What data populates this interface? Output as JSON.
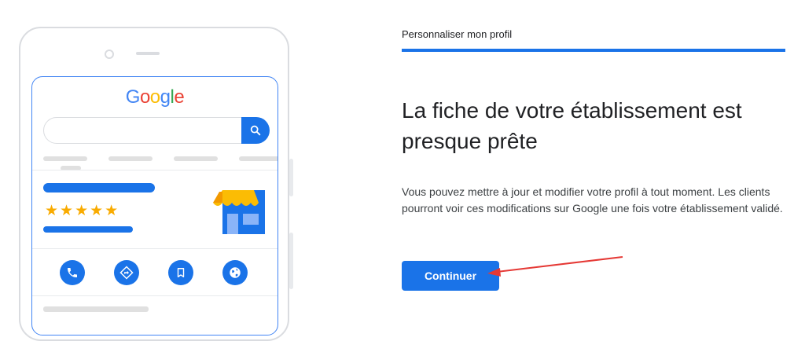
{
  "illustration": {
    "logo_letters": [
      {
        "char": "G",
        "color": "#4285F4"
      },
      {
        "char": "o",
        "color": "#EA4335"
      },
      {
        "char": "o",
        "color": "#FBBC05"
      },
      {
        "char": "g",
        "color": "#4285F4"
      },
      {
        "char": "l",
        "color": "#34A853"
      },
      {
        "char": "e",
        "color": "#EA4335"
      }
    ],
    "rating_stars": "★★★★★",
    "rating_value": 5,
    "icons": [
      "search-icon",
      "store-icon",
      "phone-icon",
      "directions-icon",
      "bookmark-icon",
      "globe-icon"
    ]
  },
  "wizard": {
    "step_title": "Personnaliser mon profil",
    "progress": 1.0,
    "headline": "La fiche de votre établissement est presque prête",
    "description": "Vous pouvez mettre à jour et modifier votre profil à tout moment. Les clients pourront voir ces modifications sur Google une fois votre établissement validé.",
    "continue_label": "Continuer"
  },
  "colors": {
    "accent": "#1A73E8",
    "star": "#F9AB00",
    "annotation_arrow": "#E53935"
  }
}
